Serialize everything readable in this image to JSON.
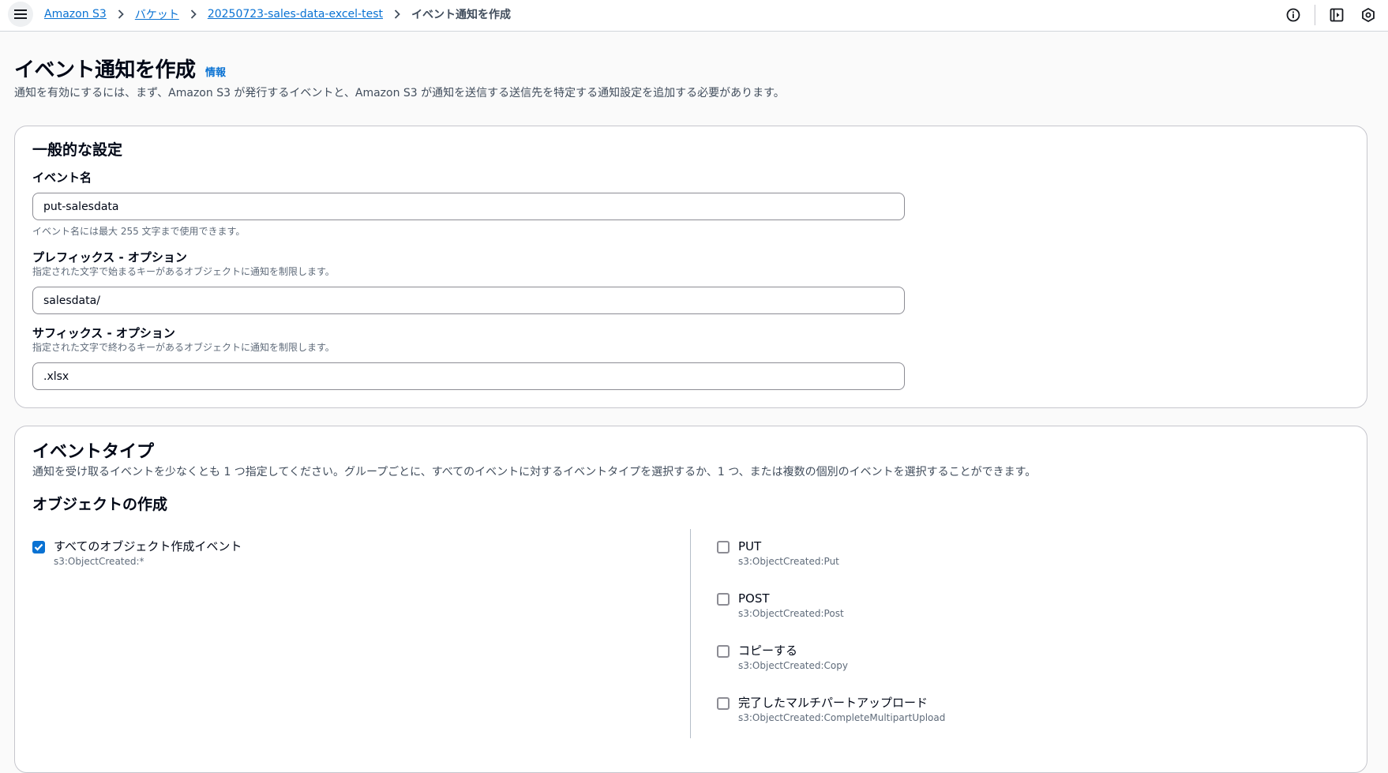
{
  "breadcrumb": {
    "items": [
      "Amazon S3",
      "バケット",
      "20250723-sales-data-excel-test"
    ],
    "current": "イベント通知を作成"
  },
  "header": {
    "title": "イベント通知を作成",
    "info": "情報",
    "description": "通知を有効にするには、まず、Amazon S3 が発行するイベントと、Amazon S3 が通知を送信する送信先を特定する通知設定を追加する必要があります。"
  },
  "general": {
    "title": "一般的な設定",
    "event_name": {
      "label": "イベント名",
      "value": "put-salesdata",
      "help": "イベント名には最大 255 文字まで使用できます。"
    },
    "prefix": {
      "label": "プレフィックス - オプション",
      "help": "指定された文字で始まるキーがあるオブジェクトに通知を制限します。",
      "value": "salesdata/"
    },
    "suffix": {
      "label": "サフィックス - オプション",
      "help": "指定された文字で終わるキーがあるオブジェクトに通知を制限します。",
      "value": ".xlsx"
    }
  },
  "event_types": {
    "title": "イベントタイプ",
    "description": "通知を受け取るイベントを少なくとも 1 つ指定してください。グループごとに、すべてのイベントに対するイベントタイプを選択するか、1 つ、または複数の個別のイベントを選択することができます。",
    "group_title": "オブジェクトの作成",
    "all": {
      "label": "すべてのオブジェクト作成イベント",
      "code": "s3:ObjectCreated:*",
      "checked": true
    },
    "items": [
      {
        "label": "PUT",
        "code": "s3:ObjectCreated:Put",
        "checked": false
      },
      {
        "label": "POST",
        "code": "s3:ObjectCreated:Post",
        "checked": false
      },
      {
        "label": "コピーする",
        "code": "s3:ObjectCreated:Copy",
        "checked": false
      },
      {
        "label": "完了したマルチパートアップロード",
        "code": "s3:ObjectCreated:CompleteMultipartUpload",
        "checked": false
      }
    ]
  },
  "colors": {
    "link": "#0972d3",
    "checkbox_checked": "#0972d3",
    "border": "#c6c6cd"
  }
}
